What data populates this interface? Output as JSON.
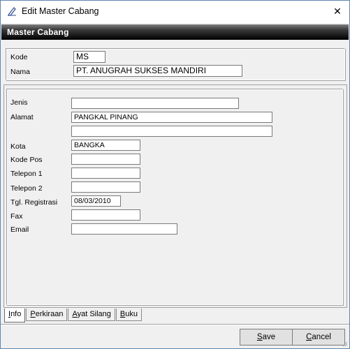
{
  "window": {
    "title": "Edit Master Cabang",
    "close_glyph": "✕",
    "icon": "pen-edit-icon"
  },
  "header": {
    "title": "Master  Cabang"
  },
  "top_fields": {
    "kode_label": "Kode",
    "kode_value": "MS",
    "nama_label": "Nama",
    "nama_value": "PT. ANUGRAH SUKSES MANDIRI"
  },
  "info_form": {
    "jenis_label": "Jenis",
    "jenis_value": "",
    "alamat_label": "Alamat",
    "alamat_value": "PANGKAL PINANG",
    "alamat2_value": "",
    "kota_label": "Kota",
    "kota_value": "BANGKA",
    "kodepos_label": "Kode Pos",
    "kodepos_value": "",
    "telepon1_label": "Telepon 1",
    "telepon1_value": "",
    "telepon2_label": "Telepon 2",
    "telepon2_value": "",
    "tgl_label_first": "T",
    "tgl_label_u": "g",
    "tgl_label_rest": "l. Registrasi",
    "tgl_value": "08/03/2010",
    "fax_label": "Fax",
    "fax_value": "",
    "email_label": "Email",
    "email_value": ""
  },
  "tabs": {
    "info_u": "I",
    "info_rest": "nfo",
    "perkiraan_u": "P",
    "perkiraan_rest": "erkiraan",
    "ayat_u": "A",
    "ayat_rest": "yat Silang",
    "buku_u": "B",
    "buku_rest": "uku"
  },
  "buttons": {
    "save_u": "S",
    "save_rest": "ave",
    "cancel_u": "C",
    "cancel_rest": "ancel"
  }
}
